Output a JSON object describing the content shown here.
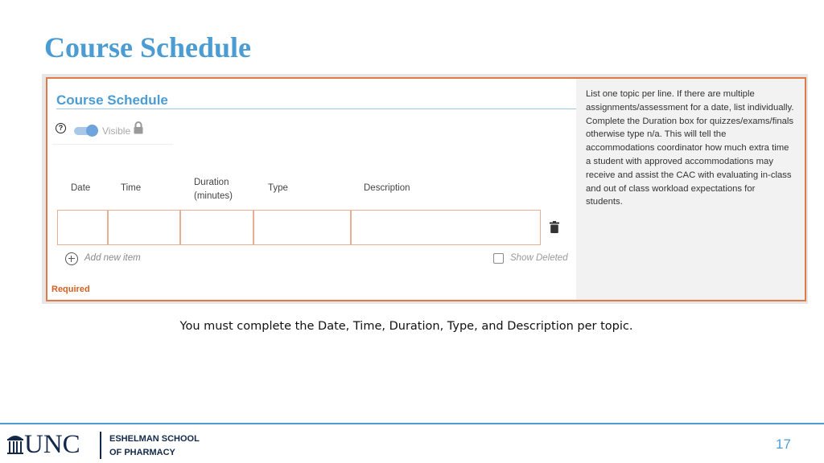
{
  "slide": {
    "title": "Course Schedule",
    "caption": "You must complete the Date, Time, Duration, Type, and Description per topic.",
    "page_number": "17"
  },
  "form": {
    "title": "Course Schedule",
    "help_icon_glyph": "?",
    "visibility_label": "Visible",
    "toggle_on": true,
    "columns": {
      "date": "Date",
      "time": "Time",
      "duration_line1": "Duration",
      "duration_line2": "(minutes)",
      "type": "Type",
      "description": "Description"
    },
    "add_item_label": "Add new item",
    "show_deleted_label": "Show Deleted",
    "show_deleted_checked": false,
    "required_label": "Required"
  },
  "help_text": {
    "lines": [
      "List one topic per line.  If there are multiple",
      "assignments/assessment for a date, list individually.",
      "Complete the Duration box for quizzes/exams/finals",
      "otherwise type n/a. This will tell the",
      "accommodations coordinator how much extra time",
      "a student with approved accommodations may",
      "receive and assist the CAC with evaluating in-class",
      "and out of class workload expectations for",
      "students."
    ]
  },
  "footer": {
    "logo_text": "UNC",
    "school_line1": "ESHELMAN SCHOOL",
    "school_line2": "OF PHARMACY"
  },
  "colors": {
    "accent_blue": "#4b9cd3",
    "highlight_border": "#e07a4a",
    "required_orange": "#d45e1f",
    "navy": "#13294b"
  },
  "icons": [
    "question-circle-icon",
    "lock-icon",
    "trash-icon",
    "add-circle-icon",
    "checkbox-icon",
    "old-well-icon"
  ]
}
